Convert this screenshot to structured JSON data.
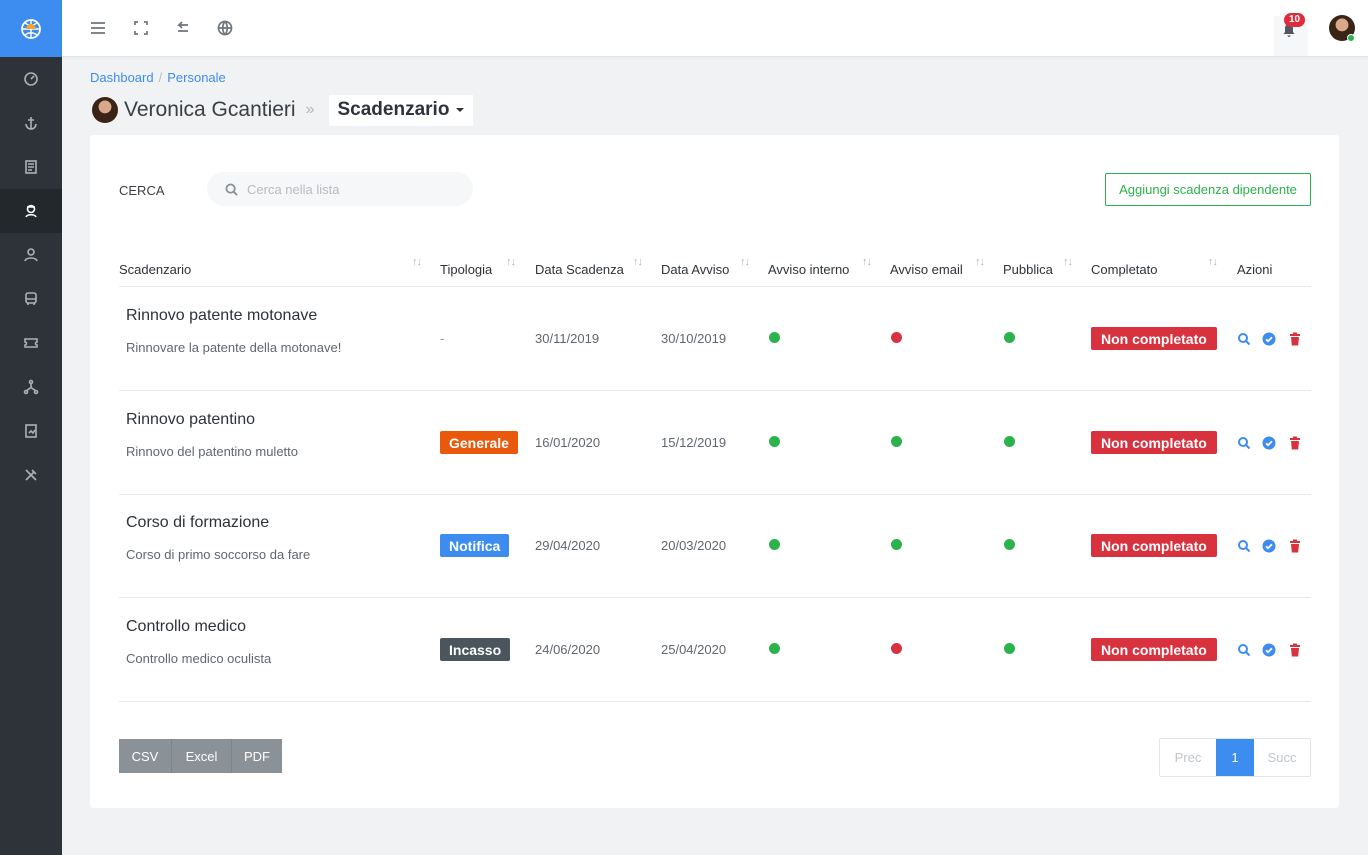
{
  "topbar": {
    "notifications_count": "10"
  },
  "sidebar": {
    "items": [
      {
        "icon": "dashboard-gauge-icon"
      },
      {
        "icon": "anchor-icon"
      },
      {
        "icon": "document-list-icon"
      },
      {
        "icon": "staff-icon",
        "active": true
      },
      {
        "icon": "users-icon"
      },
      {
        "icon": "bus-icon"
      },
      {
        "icon": "ticket-icon"
      },
      {
        "icon": "network-icon"
      },
      {
        "icon": "report-icon"
      },
      {
        "icon": "tools-icon"
      }
    ]
  },
  "breadcrumb": {
    "home": "Dashboard",
    "separator": "/",
    "current": "Personale"
  },
  "header": {
    "person_name": "Veronica Gcantieri",
    "separator": "»",
    "section": "Scadenzario"
  },
  "search": {
    "label": "CERCA",
    "placeholder": "Cerca nella lista",
    "value": ""
  },
  "add_button": "Aggiungi scadenza dipendente",
  "table": {
    "columns": [
      "Scadenzario",
      "Tipologia",
      "Data Scadenza",
      "Data Avviso",
      "Avviso interno",
      "Avviso email",
      "Pubblica",
      "Completato",
      "Azioni"
    ],
    "rows": [
      {
        "title": "Rinnovo patente motonave",
        "subtitle": "Rinnovare la patente della motonave!",
        "type": "-",
        "due_date": "30/11/2019",
        "notice_date": "30/10/2019",
        "internal_notice": "green",
        "email_notice": "red",
        "published": "green",
        "completed": "Non completato"
      },
      {
        "title": "Rinnovo patentino",
        "subtitle": "Rinnovo del patentino muletto",
        "type": "Generale",
        "type_color": "#e8590c",
        "due_date": "16/01/2020",
        "notice_date": "15/12/2019",
        "internal_notice": "green",
        "email_notice": "green",
        "published": "green",
        "completed": "Non completato"
      },
      {
        "title": "Corso di formazione",
        "subtitle": "Corso di primo soccorso da fare",
        "type": "Notifica",
        "type_color": "#3d8cf0",
        "due_date": "29/04/2020",
        "notice_date": "20/03/2020",
        "internal_notice": "green",
        "email_notice": "green",
        "published": "green",
        "completed": "Non completato"
      },
      {
        "title": "Controllo medico",
        "subtitle": "Controllo medico oculista",
        "type": "Incasso",
        "type_color": "#4b555e",
        "due_date": "24/06/2020",
        "notice_date": "25/04/2020",
        "internal_notice": "green",
        "email_notice": "red",
        "published": "green",
        "completed": "Non completato"
      }
    ]
  },
  "export": {
    "csv": "CSV",
    "excel": "Excel",
    "pdf": "PDF"
  },
  "pagination": {
    "prev": "Prec",
    "current": "1",
    "next": "Succ"
  },
  "colors": {
    "accent": "#3d8cf0",
    "success": "#2bb24c",
    "danger": "#d9323f",
    "sidebar": "#2d3338"
  }
}
